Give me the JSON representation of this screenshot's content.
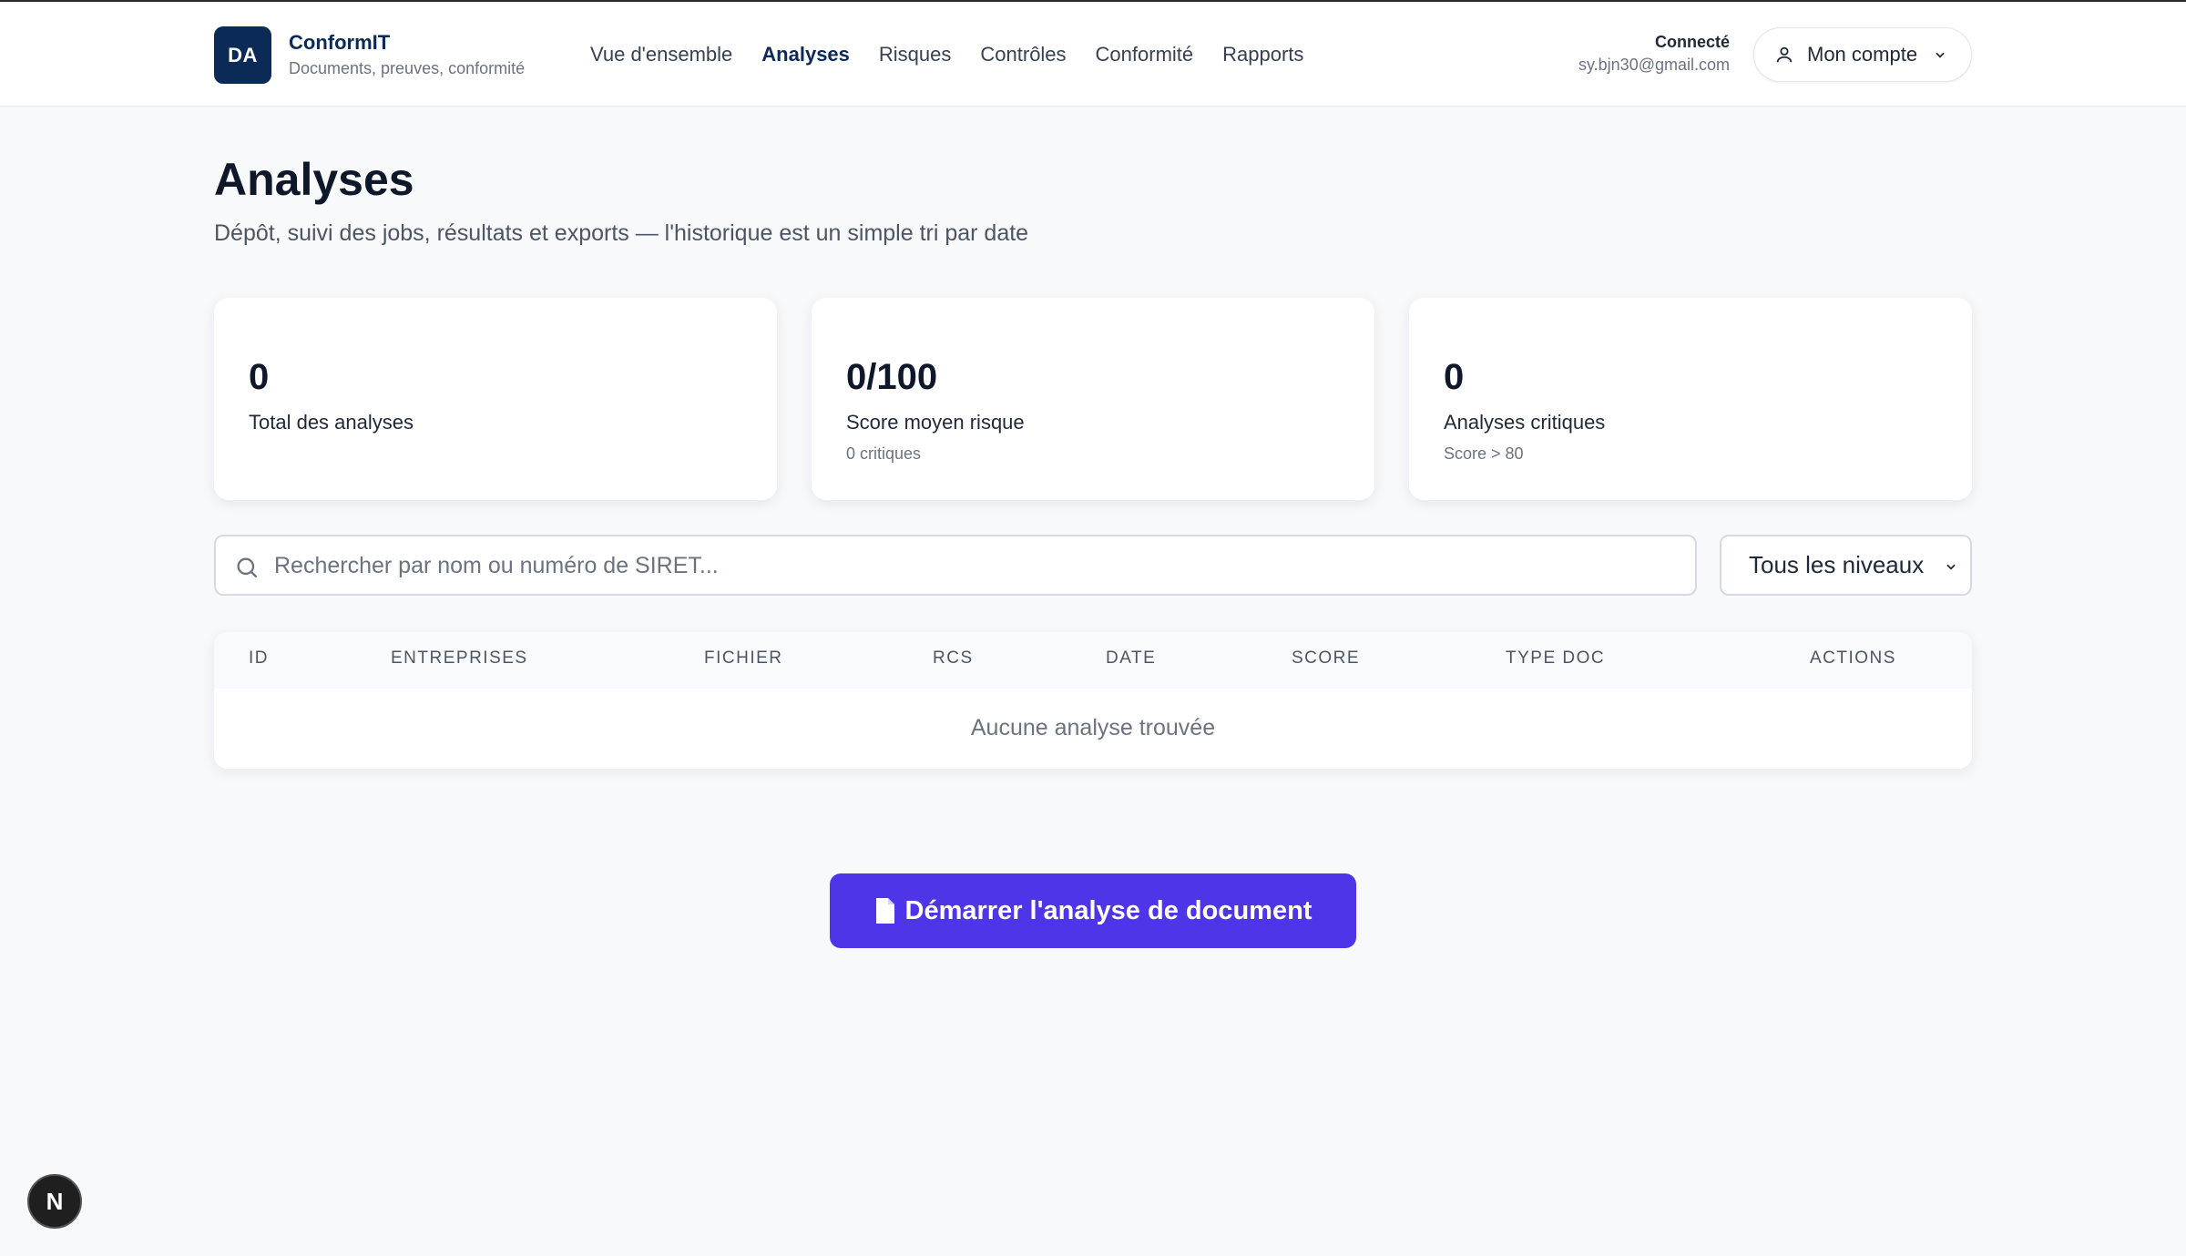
{
  "header": {
    "logo_initials": "DA",
    "brand_name": "ConformIT",
    "brand_subtitle": "Documents, preuves, conformité",
    "nav": [
      {
        "label": "Vue d'ensemble",
        "active": false
      },
      {
        "label": "Analyses",
        "active": true
      },
      {
        "label": "Risques",
        "active": false
      },
      {
        "label": "Contrôles",
        "active": false
      },
      {
        "label": "Conformité",
        "active": false
      },
      {
        "label": "Rapports",
        "active": false
      }
    ],
    "user_status_label": "Connecté",
    "user_email": "sy.bjn30@gmail.com",
    "account_button": "Mon compte"
  },
  "main": {
    "title": "Analyses",
    "subtitle": "Dépôt, suivi des jobs, résultats et exports — l'historique est un simple tri par date",
    "stats": [
      {
        "value": "0",
        "label": "Total des analyses",
        "note": ""
      },
      {
        "value": "0/100",
        "label": "Score moyen risque",
        "note": "0 critiques"
      },
      {
        "value": "0",
        "label": "Analyses critiques",
        "note": "Score > 80"
      }
    ],
    "search_placeholder": "Rechercher par nom ou numéro de SIRET...",
    "level_filter": "Tous les niveaux",
    "table": {
      "columns": [
        "ID",
        "ENTREPRISES",
        "FICHIER",
        "RCS",
        "DATE",
        "SCORE",
        "TYPE DOC",
        "ACTIONS"
      ],
      "empty_message": "Aucune analyse trouvée"
    },
    "start_button": "Démarrer l'analyse de document"
  },
  "dev_badge": "N",
  "colors": {
    "brand": "#0b2a55",
    "accent": "#4f35e8"
  }
}
